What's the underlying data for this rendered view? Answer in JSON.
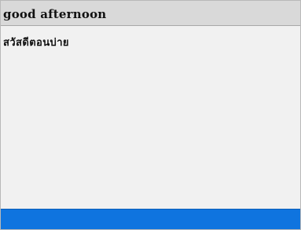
{
  "header": {
    "title": "good afternoon"
  },
  "content": {
    "line_1": "สวัสดีตอนบ่าย"
  },
  "colors": {
    "header_bg": "#d9d9d9",
    "content_bg": "#f1f1f1",
    "bottom_bar": "#0f74df"
  }
}
